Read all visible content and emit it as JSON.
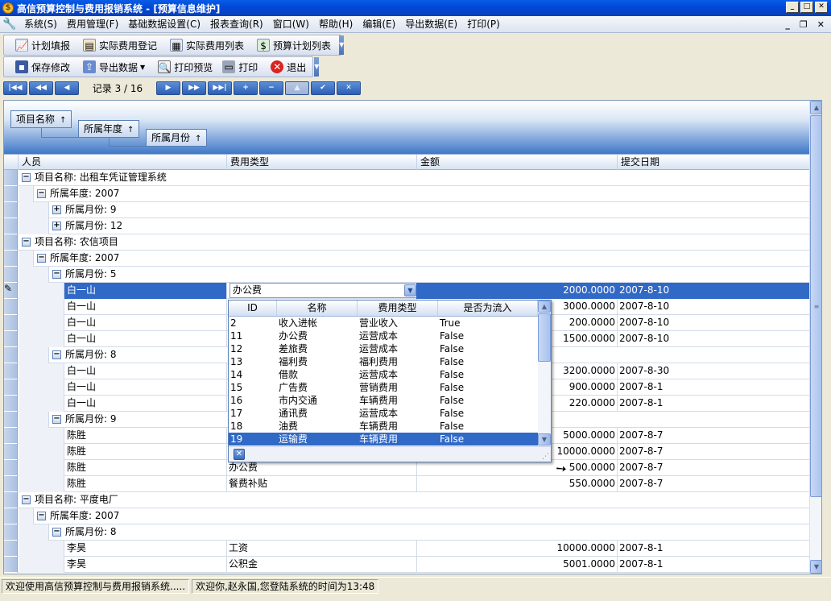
{
  "window": {
    "title": "高信预算控制与费用报销系统 - [预算信息维护]",
    "app_icon": "$",
    "btn_min": "_",
    "btn_restore": "□",
    "btn_close": "✕"
  },
  "menubar": {
    "items": [
      "系统(S)",
      "费用管理(F)",
      "基础数据设置(C)",
      "报表查询(R)",
      "窗口(W)",
      "帮助(H)",
      "编辑(E)",
      "导出数据(E)",
      "打印(P)"
    ],
    "mdi_min": "_",
    "mdi_restore": "❐",
    "mdi_close": "✕"
  },
  "toolbar1": {
    "items": [
      {
        "label": "计划填报",
        "icon": "chart-icon",
        "glyph": "📈"
      },
      {
        "label": "实际费用登记",
        "icon": "form-icon",
        "glyph": "▤"
      },
      {
        "label": "实际费用列表",
        "icon": "list-icon",
        "glyph": "▦"
      },
      {
        "label": "预算计划列表",
        "icon": "dollar-icon",
        "glyph": "$"
      }
    ]
  },
  "toolbar2": {
    "save": "保存修改",
    "export": "导出数据",
    "print_preview": "打印预览",
    "print": "打印",
    "exit": "退出"
  },
  "navigator": {
    "record_label": "记录 3 / 16"
  },
  "grid": {
    "group_chips": [
      "项目名称",
      "所属年度",
      "所属月份"
    ],
    "sort_arrow": "↑",
    "columns": [
      "人员",
      "费用类型",
      "金额",
      "提交日期"
    ],
    "rows": [
      {
        "kind": "group",
        "level": 0,
        "state": "-",
        "text": "项目名称: 出租车凭证管理系统"
      },
      {
        "kind": "group",
        "level": 1,
        "state": "-",
        "text": "所属年度: 2007"
      },
      {
        "kind": "group",
        "level": 2,
        "state": "+",
        "text": "所属月份: 9"
      },
      {
        "kind": "group",
        "level": 2,
        "state": "+",
        "text": "所属月份: 12"
      },
      {
        "kind": "group",
        "level": 0,
        "state": "-",
        "text": "项目名称: 农信项目"
      },
      {
        "kind": "group",
        "level": 1,
        "state": "-",
        "text": "所属年度: 2007"
      },
      {
        "kind": "group",
        "level": 2,
        "state": "-",
        "text": "所属月份: 5"
      },
      {
        "kind": "data",
        "selected": true,
        "person": "白一山",
        "type": "办公费",
        "amount": "2000.0000",
        "date": "2007-8-10"
      },
      {
        "kind": "data",
        "person": "白一山",
        "type": "",
        "amount": "3000.0000",
        "date": "2007-8-10"
      },
      {
        "kind": "data",
        "person": "白一山",
        "type": "",
        "amount": "200.0000",
        "date": "2007-8-10"
      },
      {
        "kind": "data",
        "person": "白一山",
        "type": "",
        "amount": "1500.0000",
        "date": "2007-8-10"
      },
      {
        "kind": "group",
        "level": 2,
        "state": "-",
        "text": "所属月份: 8"
      },
      {
        "kind": "data",
        "person": "白一山",
        "type": "",
        "amount": "3200.0000",
        "date": "2007-8-30"
      },
      {
        "kind": "data",
        "person": "白一山",
        "type": "",
        "amount": "900.0000",
        "date": "2007-8-1"
      },
      {
        "kind": "data",
        "person": "白一山",
        "type": "",
        "amount": "220.0000",
        "date": "2007-8-1"
      },
      {
        "kind": "group",
        "level": 2,
        "state": "-",
        "text": "所属月份: 9"
      },
      {
        "kind": "data",
        "person": "陈胜",
        "type": "",
        "amount": "5000.0000",
        "date": "2007-8-7"
      },
      {
        "kind": "data",
        "person": "陈胜",
        "type": "",
        "amount": "10000.0000",
        "date": "2007-8-7"
      },
      {
        "kind": "data",
        "person": "陈胜",
        "type": "办公费",
        "amount": "500.0000",
        "date": "2007-8-7"
      },
      {
        "kind": "data",
        "person": "陈胜",
        "type": "餐费补贴",
        "amount": "550.0000",
        "date": "2007-8-7"
      },
      {
        "kind": "group",
        "level": 0,
        "state": "-",
        "text": "项目名称: 平度电厂"
      },
      {
        "kind": "group",
        "level": 1,
        "state": "-",
        "text": "所属年度: 2007"
      },
      {
        "kind": "group",
        "level": 2,
        "state": "-",
        "text": "所属月份: 8"
      },
      {
        "kind": "data",
        "person": "李昊",
        "type": "工资",
        "amount": "10000.0000",
        "date": "2007-8-1"
      },
      {
        "kind": "data",
        "person": "李昊",
        "type": "公积金",
        "amount": "5001.0000",
        "date": "2007-8-1"
      }
    ]
  },
  "lookup": {
    "columns": [
      "ID",
      "名称",
      "费用类型",
      "是否为流入"
    ],
    "rows": [
      {
        "id": "2",
        "name": "收入进帐",
        "type": "营业收入",
        "inflow": "True"
      },
      {
        "id": "11",
        "name": "办公费",
        "type": "运营成本",
        "inflow": "False"
      },
      {
        "id": "12",
        "name": "差旅费",
        "type": "运营成本",
        "inflow": "False"
      },
      {
        "id": "13",
        "name": "福利费",
        "type": "福利费用",
        "inflow": "False"
      },
      {
        "id": "14",
        "name": "借款",
        "type": "运营成本",
        "inflow": "False"
      },
      {
        "id": "15",
        "name": "广告费",
        "type": "营销费用",
        "inflow": "False"
      },
      {
        "id": "16",
        "name": "市内交通",
        "type": "车辆费用",
        "inflow": "False"
      },
      {
        "id": "17",
        "name": "通讯费",
        "type": "运营成本",
        "inflow": "False"
      },
      {
        "id": "18",
        "name": "油费",
        "type": "车辆费用",
        "inflow": "False"
      },
      {
        "id": "19",
        "name": "运输费",
        "type": "车辆费用",
        "inflow": "False",
        "selected": true
      }
    ],
    "close_glyph": "✕"
  },
  "statusbar": {
    "left": "欢迎使用高信预算控制与费用报销系统.....",
    "right": "欢迎你,赵永国,您登陆系统的时间为13:48"
  }
}
